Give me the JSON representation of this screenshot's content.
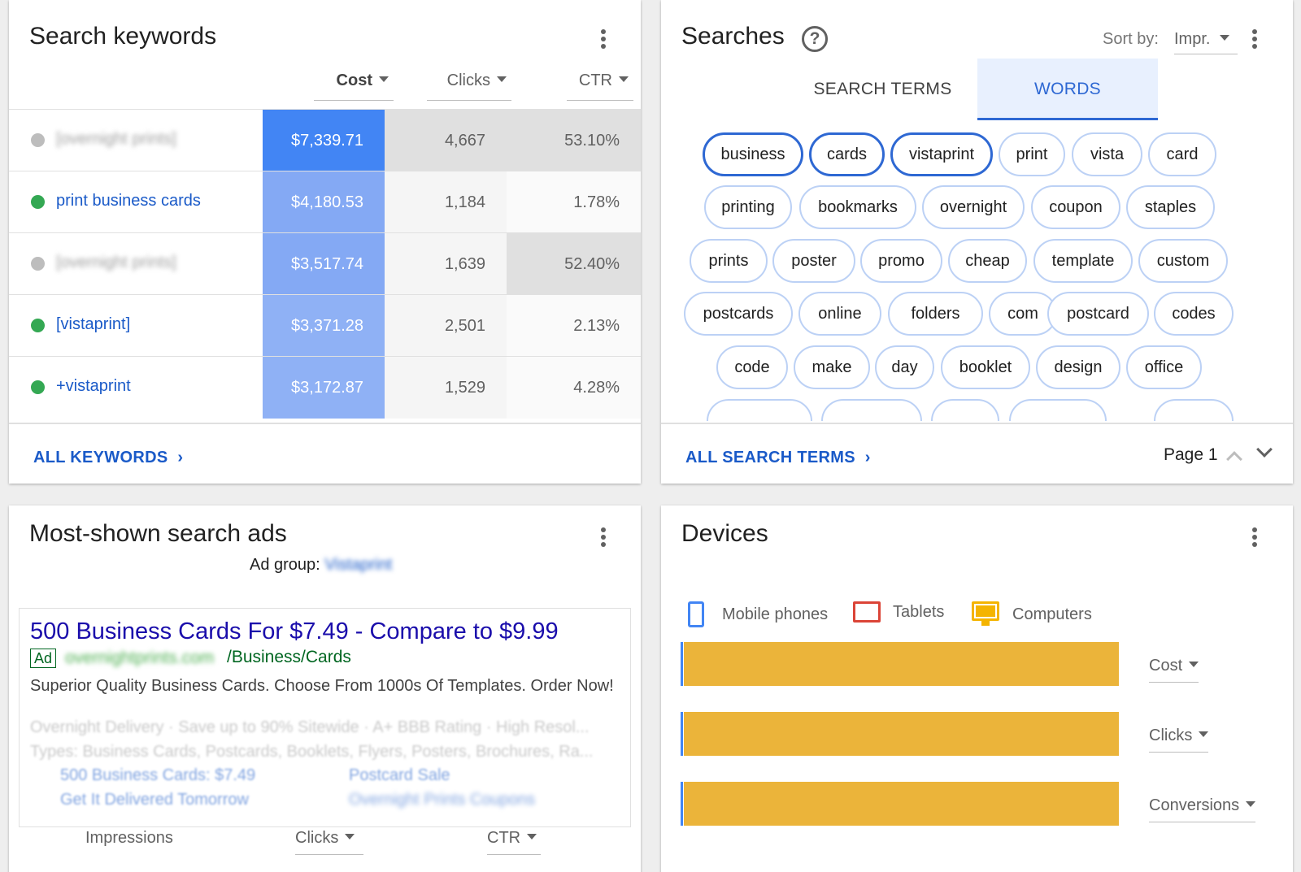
{
  "keywords_card": {
    "title": "Search keywords",
    "columns": {
      "cost": "Cost",
      "clicks": "Clicks",
      "ctr": "CTR"
    },
    "rows": [
      {
        "keyword": "[overnight prints]",
        "blurred": true,
        "status_color": "#bdbdbd",
        "cost": "$7,339.71",
        "clicks": "4,667",
        "ctr": "53.10%"
      },
      {
        "keyword": "print business cards",
        "blurred": false,
        "status_color": "#34a853",
        "cost": "$4,180.53",
        "clicks": "1,184",
        "ctr": "1.78%"
      },
      {
        "keyword": "[overnight prints]",
        "blurred": true,
        "status_color": "#bdbdbd",
        "cost": "$3,517.74",
        "clicks": "1,639",
        "ctr": "52.40%"
      },
      {
        "keyword": "[vistaprint]",
        "blurred": false,
        "status_color": "#34a853",
        "cost": "$3,371.28",
        "clicks": "2,501",
        "ctr": "2.13%"
      },
      {
        "keyword": "+vistaprint",
        "blurred": false,
        "status_color": "#34a853",
        "cost": "$3,172.87",
        "clicks": "1,529",
        "ctr": "4.28%"
      }
    ],
    "footer_link": "ALL KEYWORDS"
  },
  "searches_card": {
    "title": "Searches",
    "sort_label": "Sort by:",
    "sort_value": "Impr.",
    "tabs": [
      "SEARCH TERMS",
      "WORDS"
    ],
    "active_tab": "WORDS",
    "words": [
      [
        "business",
        "cards",
        "vistaprint",
        "print",
        "vista",
        "card"
      ],
      [
        "printing",
        "bookmarks",
        "overnight",
        "coupon",
        "staples"
      ],
      [
        "prints",
        "poster",
        "promo",
        "cheap",
        "template",
        "custom"
      ],
      [
        "postcards",
        "online",
        "folders",
        "com",
        "postcard",
        "codes"
      ],
      [
        "code",
        "make",
        "day",
        "booklet",
        "design",
        "office"
      ]
    ],
    "footer_link": "ALL SEARCH TERMS",
    "page_label": "Page 1"
  },
  "ads_card": {
    "title": "Most-shown search ads",
    "ad_group_label": "Ad group:",
    "ad_group_value": "Vistaprint",
    "ad": {
      "headline": "500 Business Cards For $7.49 - Compare to $9.99",
      "badge": "Ad",
      "display_url_blurred": "overnightprints.com",
      "display_url_path": "/Business/Cards",
      "description": "Superior Quality Business Cards. Choose From 1000s Of Templates. Order Now!",
      "callouts": "Overnight Delivery · Save up to 90% Sitewide · A+ BBB Rating · High Resol...",
      "snippets": "Types: Business Cards, Postcards, Booklets, Flyers, Posters, Brochures, Ra...",
      "sitelinks": [
        "500 Business Cards: $7.49",
        "Postcard Sale",
        "Get It Delivered Tomorrow",
        "Overnight Prints Coupons"
      ]
    },
    "metrics": [
      "Impressions",
      "Clicks",
      "CTR"
    ]
  },
  "devices_card": {
    "title": "Devices",
    "legend": [
      {
        "label": "Mobile phones",
        "icon": "phone-icon",
        "color": "#4285f4"
      },
      {
        "label": "Tablets",
        "icon": "tablet-icon",
        "color": "#db4437"
      },
      {
        "label": "Computers",
        "icon": "computer-icon",
        "color": "#f4b400"
      }
    ],
    "metrics": [
      {
        "label": "Cost",
        "computers_share": 0.99
      },
      {
        "label": "Clicks",
        "computers_share": 0.99
      },
      {
        "label": "Conversions",
        "computers_share": 0.99
      }
    ]
  },
  "colors": {
    "link_blue": "#1a5ac8",
    "chip_border": "#bcd1f5",
    "chip_selected": "#2e68d3",
    "bar_computers": "#ebb43a",
    "tab_active_bg": "#e8f0fe"
  }
}
